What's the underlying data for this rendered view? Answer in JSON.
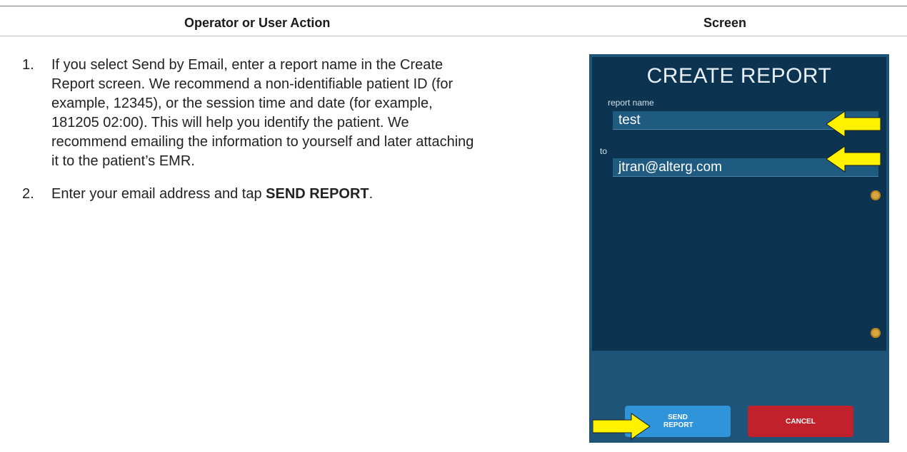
{
  "table": {
    "header_action": "Operator or User Action",
    "header_screen": "Screen"
  },
  "steps": [
    {
      "number": "1.",
      "text": "If you select Send by Email, enter a report name in the Create Report screen. We recommend a non-identifiable patient ID (for example, 12345), or the session time and date (for example, 181205 02:00). This will help you identify the patient. We recommend emailing the information to yourself and later attaching it to the patient’s EMR."
    },
    {
      "number": "2.",
      "text_before": "Enter your email address and tap ",
      "text_bold": "SEND REPORT",
      "text_after": "."
    }
  ],
  "device": {
    "title": "CREATE REPORT",
    "report_name_label": "report name",
    "report_name_value": "test",
    "to_label": "to",
    "to_value": "jtran@alterg.com",
    "send_button": "SEND REPORT",
    "cancel_button": "CANCEL",
    "colors": {
      "panel": "#0c3450",
      "frame": "#1e5478",
      "send": "#2f94d9",
      "cancel": "#c0212a",
      "arrow": "#fff200"
    },
    "icons": [
      "callout-arrow-icon",
      "scroll-indicator-icon"
    ]
  }
}
